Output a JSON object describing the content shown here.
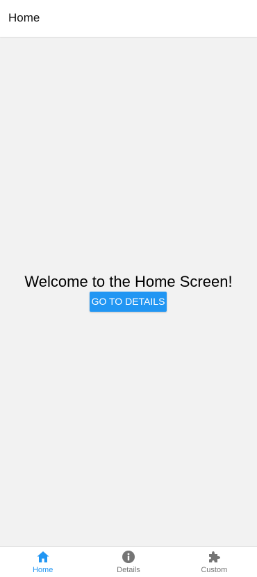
{
  "header": {
    "title": "Home"
  },
  "main": {
    "welcome_text": "Welcome to the Home Screen!",
    "details_button_label": "GO TO DETAILS"
  },
  "tabbar": {
    "active_color": "#2196f3",
    "inactive_color": "#757575",
    "tabs": [
      {
        "label": "Home",
        "icon": "home-icon",
        "active": true
      },
      {
        "label": "Details",
        "icon": "info-icon",
        "active": false
      },
      {
        "label": "Custom",
        "icon": "puzzle-icon",
        "active": false
      }
    ]
  }
}
